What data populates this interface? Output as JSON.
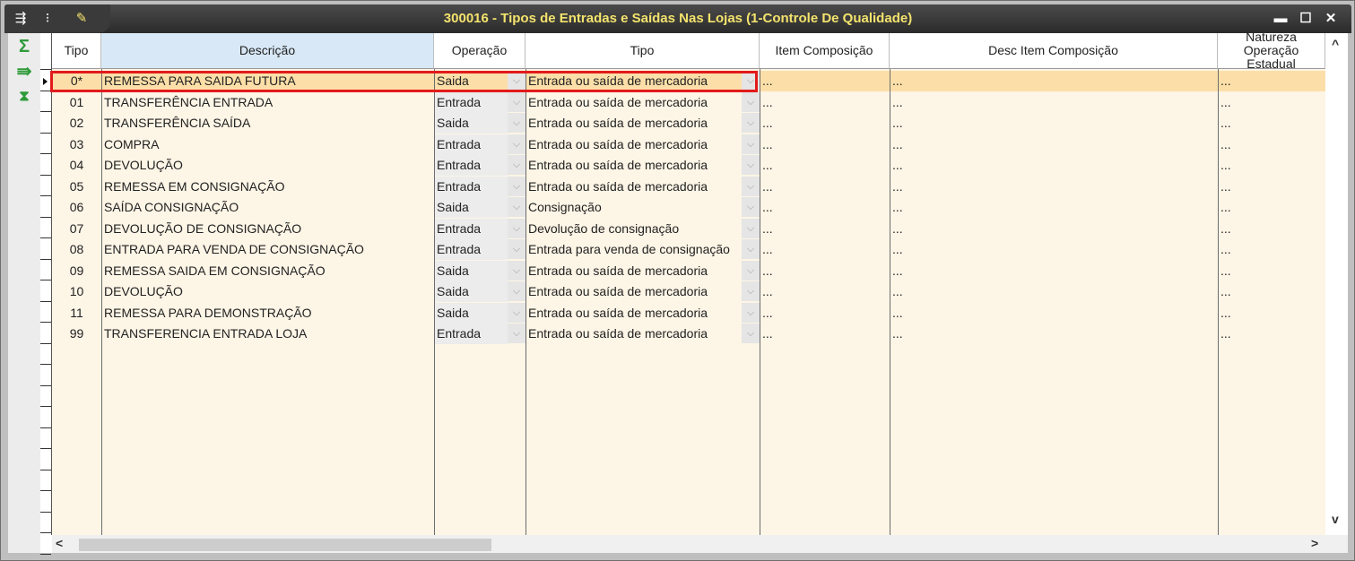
{
  "window": {
    "title": "300016 - Tipos de Entradas e Saídas Nas Lojas (1-Controle De Qualidade)",
    "icons": [
      "export-icon",
      "traffic-light-icon",
      "wrench-icon"
    ],
    "controls": {
      "minimize": "▬",
      "maximize": "☐",
      "close": "✕"
    }
  },
  "toolbar": {
    "items": [
      "sum-icon",
      "export-green-icon",
      "filter-icon"
    ],
    "symbols": {
      "sum": "Σ",
      "export": "⇛",
      "filter": "⧗"
    }
  },
  "columns": {
    "tipo": "Tipo",
    "descricao": "Descrição",
    "operacao": "Operação",
    "tipo2": "Tipo",
    "item_composicao": "Item Composição",
    "desc_item_composicao": "Desc Item Composição",
    "natureza_l1": "Natureza",
    "natureza_l2": "Operação Estadual"
  },
  "rows": [
    {
      "tipo": "0*",
      "descricao": "REMESSA PARA SAIDA FUTURA",
      "operacao": "Saida",
      "tipo2": "Entrada ou saída de mercadoria",
      "item": "...",
      "desc": "...",
      "natureza": "..."
    },
    {
      "tipo": "01",
      "descricao": "TRANSFERÊNCIA ENTRADA",
      "operacao": "Entrada",
      "tipo2": "Entrada ou saída de mercadoria",
      "item": "...",
      "desc": "...",
      "natureza": "..."
    },
    {
      "tipo": "02",
      "descricao": "TRANSFERÊNCIA SAÍDA",
      "operacao": "Saida",
      "tipo2": "Entrada ou saída de mercadoria",
      "item": "...",
      "desc": "...",
      "natureza": "..."
    },
    {
      "tipo": "03",
      "descricao": "COMPRA",
      "operacao": "Entrada",
      "tipo2": "Entrada ou saída de mercadoria",
      "item": "...",
      "desc": "...",
      "natureza": "..."
    },
    {
      "tipo": "04",
      "descricao": "DEVOLUÇÃO",
      "operacao": "Entrada",
      "tipo2": "Entrada ou saída de mercadoria",
      "item": "...",
      "desc": "...",
      "natureza": "..."
    },
    {
      "tipo": "05",
      "descricao": "REMESSA EM CONSIGNAÇÃO",
      "operacao": "Entrada",
      "tipo2": "Entrada ou saída de mercadoria",
      "item": "...",
      "desc": "...",
      "natureza": "..."
    },
    {
      "tipo": "06",
      "descricao": "SAÍDA CONSIGNAÇÃO",
      "operacao": "Saida",
      "tipo2": "Consignação",
      "item": "...",
      "desc": "...",
      "natureza": "..."
    },
    {
      "tipo": "07",
      "descricao": "DEVOLUÇÃO DE CONSIGNAÇÃO",
      "operacao": "Entrada",
      "tipo2": "Devolução de consignação",
      "item": "...",
      "desc": "...",
      "natureza": "..."
    },
    {
      "tipo": "08",
      "descricao": "ENTRADA PARA VENDA DE CONSIGNAÇÃO",
      "operacao": "Entrada",
      "tipo2": "Entrada para venda de consignação",
      "item": "...",
      "desc": "...",
      "natureza": "..."
    },
    {
      "tipo": "09",
      "descricao": "REMESSA SAIDA EM CONSIGNAÇÃO",
      "operacao": "Saida",
      "tipo2": "Entrada ou saída de mercadoria",
      "item": "...",
      "desc": "...",
      "natureza": "..."
    },
    {
      "tipo": "10",
      "descricao": "DEVOLUÇÃO",
      "operacao": "Saida",
      "tipo2": "Entrada ou saída de mercadoria",
      "item": "...",
      "desc": "...",
      "natureza": "..."
    },
    {
      "tipo": "11",
      "descricao": "REMESSA PARA DEMONSTRAÇÃO",
      "operacao": "Saida",
      "tipo2": "Entrada ou saída de mercadoria",
      "item": "...",
      "desc": "...",
      "natureza": "..."
    },
    {
      "tipo": "99",
      "descricao": "TRANSFERENCIA ENTRADA LOJA",
      "operacao": "Entrada",
      "tipo2": "Entrada ou saída de mercadoria",
      "item": "...",
      "desc": "...",
      "natureza": "..."
    }
  ],
  "scroll": {
    "left": "<",
    "right": ">",
    "up": "^",
    "down": "v"
  },
  "colors": {
    "title_text": "#f3e36d",
    "row_bg": "#fdf5e6",
    "selected_row": "#fcdfa8",
    "highlight_border": "#e21b1b"
  }
}
